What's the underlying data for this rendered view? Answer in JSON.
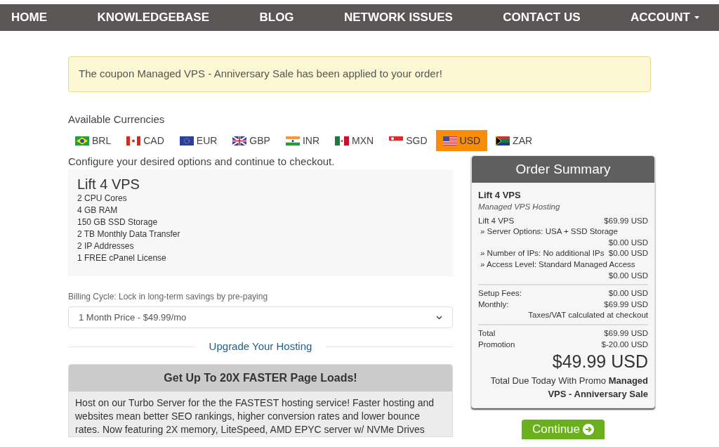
{
  "nav": [
    {
      "label": "HOME",
      "dropdown": false
    },
    {
      "label": "KNOWLEDGEBASE",
      "dropdown": false
    },
    {
      "label": "BLOG",
      "dropdown": false
    },
    {
      "label": "NETWORK ISSUES",
      "dropdown": false
    },
    {
      "label": "CONTACT US",
      "dropdown": false
    },
    {
      "label": "ACCOUNT",
      "dropdown": true
    }
  ],
  "alert": "The coupon Managed VPS - Anniversary Sale has been applied to your order!",
  "currencies": {
    "title": "Available Currencies",
    "items": [
      {
        "code": "BRL",
        "kind": "br",
        "selected": false
      },
      {
        "code": "CAD",
        "kind": "ca",
        "selected": false
      },
      {
        "code": "EUR",
        "kind": "eu",
        "selected": false
      },
      {
        "code": "GBP",
        "kind": "gb",
        "selected": false
      },
      {
        "code": "INR",
        "kind": "in",
        "selected": false
      },
      {
        "code": "MXN",
        "kind": "mx",
        "selected": false
      },
      {
        "code": "SGD",
        "kind": "sg",
        "selected": false
      },
      {
        "code": "USD",
        "kind": "us",
        "selected": true
      },
      {
        "code": "ZAR",
        "kind": "za",
        "selected": false
      }
    ]
  },
  "intro": "Configure your desired options and continue to checkout.",
  "product": {
    "name": "Lift 4 VPS",
    "features": [
      "2 CPU Cores",
      "4 GB RAM",
      "150 GB SSD Storage",
      "2 TB Monthly Data Transfer",
      "2 IP Addresses",
      "1 FREE cPanel License"
    ]
  },
  "billing": {
    "label": "Billing Cycle: Lock in long-term savings by pre-paying",
    "value": "1 Month Price - $49.99/mo"
  },
  "upgrade_heading": "Upgrade Your Hosting",
  "promo": {
    "title": "Get Up To 20X FASTER Page Loads!",
    "text": "Host on our Turbo Server for the the FASTEST hosting service! Faster hosting and websites mean better SEO rankings, higher conversion rates and lower bounce rates. Now featuring 2X memory, LiteSpeed, AMD EPYC server w/ NVMe Drives"
  },
  "summary": {
    "title": "Order Summary",
    "product": "Lift 4 VPS",
    "group": "Managed VPS Hosting",
    "lines": [
      {
        "kind": "item",
        "label": "Lift 4 VPS",
        "price": "$69.99 USD"
      },
      {
        "kind": "option",
        "label": "» Server Options: USA + SSD Storage",
        "price": "$0.00 USD"
      },
      {
        "kind": "option",
        "label": "» Number of IPs: No additional IPs",
        "price": "$0.00 USD"
      },
      {
        "kind": "option",
        "label": "» Access Level: Standard Managed Access",
        "price": "$0.00 USD"
      }
    ],
    "fees": [
      {
        "label": "Setup Fees:",
        "price": "$0.00 USD"
      },
      {
        "label": "Monthly:",
        "price": "$69.99 USD"
      }
    ],
    "tax_note": "Taxes/VAT calculated at checkout",
    "totals": [
      {
        "label": "Total",
        "price": "$69.99 USD"
      },
      {
        "label": "Promotion",
        "price": "$-20.00 USD"
      }
    ],
    "amount": "$49.99 USD",
    "due_note": "Total Due Today With Promo **Managed VPS - Anniversary Sale**",
    "button": "Continue"
  }
}
